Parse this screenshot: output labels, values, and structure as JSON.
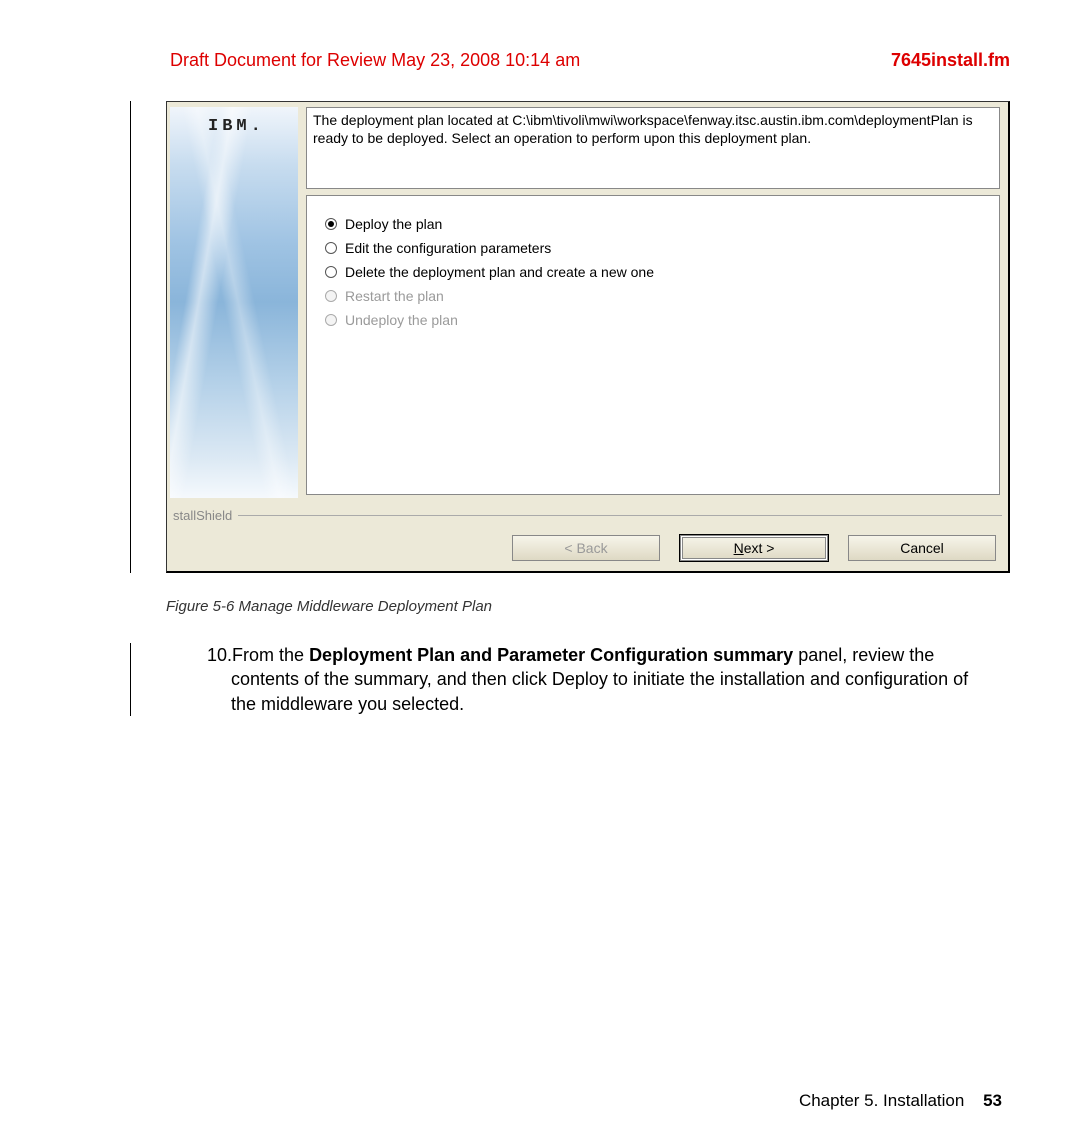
{
  "header": {
    "draft_text": "Draft Document for Review May 23, 2008 10:14 am",
    "filename": "7645install.fm"
  },
  "dialog": {
    "ibm": "IBM.",
    "description": "The deployment plan located at C:\\ibm\\tivoli\\mwi\\workspace\\fenway.itsc.austin.ibm.com\\deploymentPlan is ready to be deployed. Select an operation to perform upon this deployment plan.",
    "options": [
      {
        "label": "Deploy the plan",
        "selected": true,
        "disabled": false
      },
      {
        "label": "Edit the configuration parameters",
        "selected": false,
        "disabled": false
      },
      {
        "label": "Delete the deployment plan and create a new one",
        "selected": false,
        "disabled": false
      },
      {
        "label": "Restart the plan",
        "selected": false,
        "disabled": true
      },
      {
        "label": "Undeploy the plan",
        "selected": false,
        "disabled": true
      }
    ],
    "shield": "stallShield",
    "buttons": {
      "back": "< Back",
      "next": "Next >",
      "cancel": "Cancel"
    }
  },
  "figure_caption": "Figure 5-6   Manage Middleware Deployment Plan",
  "step": {
    "number": "10.",
    "bold": "Deployment Plan and Parameter Configuration summary",
    "pre": "From the ",
    "post": " panel, review the contents of the summary, and then click Deploy to initiate the installation and configuration of the middleware you selected."
  },
  "footer": {
    "chapter": "Chapter 5. Installation",
    "page": "53"
  }
}
